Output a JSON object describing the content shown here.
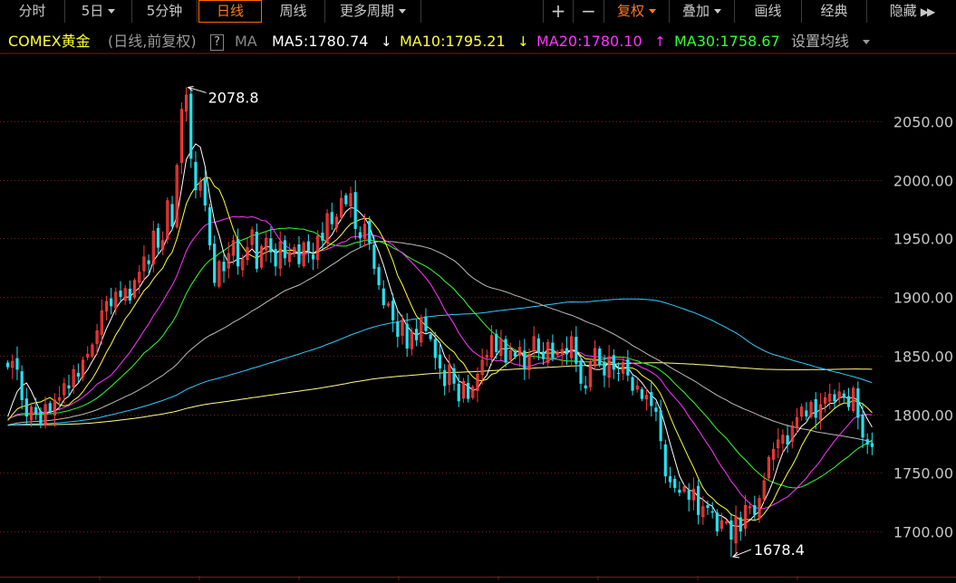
{
  "toolbar": {
    "fenshi": "分时",
    "day5": "5日",
    "min5": "5分钟",
    "daily": "日线",
    "weekly": "周线",
    "more_periods": "更多周期",
    "plus": "+",
    "minus": "−",
    "fuquan": "复权",
    "diejia": "叠加",
    "huaxian": "画线",
    "jingdian": "经典",
    "hide": "隐藏"
  },
  "info": {
    "symbol": "COMEX黄金",
    "mode": "(日线,前复权)",
    "help": "?",
    "ma_label": "MA",
    "ma5": "MA5:1780.74",
    "ma10": "MA10:1795.21",
    "ma20": "MA20:1780.10",
    "ma30": "MA30:1758.67",
    "settings": "设置均线",
    "down_arrow": "↓",
    "up_arrow": "↑"
  },
  "colors": {
    "up": "#ff3b3b",
    "down": "#25e0f0",
    "ma5": "#ffffff",
    "ma10": "#ffff33",
    "ma20": "#ff33ff",
    "ma30": "#33ff33",
    "ma60": "#bbbbbb",
    "ma120": "#33ccff",
    "ma250": "#ffff88",
    "grid": "#7a1a1a"
  },
  "chart_data": {
    "type": "candlestick",
    "ylim": [
      1668,
      2086
    ],
    "y_ticks": [
      1700,
      1750,
      1800,
      1850,
      1900,
      1950,
      2000,
      2050
    ],
    "y_tick_labels": [
      "1700.00",
      "1750.00",
      "1800.00",
      "1850.00",
      "1900.00",
      "1950.00",
      "2000.00",
      "2050.00"
    ],
    "annotations": [
      {
        "label": "2078.8",
        "value": 2078.8,
        "type": "high"
      },
      {
        "label": "1678.4",
        "value": 1678.4,
        "type": "low"
      }
    ],
    "closes": [
      1840,
      1845,
      1838,
      1812,
      1798,
      1806,
      1800,
      1792,
      1808,
      1802,
      1812,
      1814,
      1826,
      1822,
      1838,
      1832,
      1846,
      1851,
      1859,
      1871,
      1888,
      1896,
      1892,
      1904,
      1900,
      1907,
      1897,
      1914,
      1921,
      1934,
      1928,
      1956,
      1942,
      1948,
      1982,
      1960,
      2012,
      2060,
      2072,
      2018,
      1991,
      1998,
      1978,
      1944,
      1912,
      1930,
      1922,
      1937,
      1948,
      1926,
      1932,
      1942,
      1957,
      1924,
      1943,
      1950,
      1938,
      1926,
      1947,
      1933,
      1938,
      1942,
      1928,
      1946,
      1939,
      1932,
      1952,
      1948,
      1971,
      1962,
      1968,
      1984,
      1979,
      1988,
      1958,
      1950,
      1962,
      1946,
      1924,
      1910,
      1893,
      1894,
      1880,
      1866,
      1880,
      1856,
      1870,
      1863,
      1882,
      1871,
      1864,
      1848,
      1839,
      1824,
      1842,
      1826,
      1811,
      1828,
      1813,
      1823,
      1834,
      1846,
      1850,
      1867,
      1853,
      1864,
      1844,
      1854,
      1849,
      1857,
      1838,
      1851,
      1866,
      1852,
      1847,
      1861,
      1848,
      1853,
      1855,
      1851,
      1866,
      1843,
      1826,
      1822,
      1844,
      1856,
      1842,
      1833,
      1849,
      1838,
      1835,
      1844,
      1833,
      1820,
      1824,
      1813,
      1816,
      1807,
      1802,
      1777,
      1747,
      1742,
      1737,
      1733,
      1738,
      1727,
      1736,
      1714,
      1721,
      1720,
      1716,
      1700,
      1709,
      1708,
      1693,
      1712,
      1700,
      1722,
      1721,
      1714,
      1728,
      1743,
      1763,
      1770,
      1778,
      1782,
      1774,
      1790,
      1797,
      1806,
      1798,
      1810,
      1797,
      1808,
      1814,
      1817,
      1811,
      1819,
      1814,
      1806,
      1822,
      1797,
      1780,
      1774,
      1772
    ],
    "ma_values": {
      "MA5": 1780.74,
      "MA10": 1795.21,
      "MA20": 1780.1,
      "MA30": 1758.67
    }
  }
}
